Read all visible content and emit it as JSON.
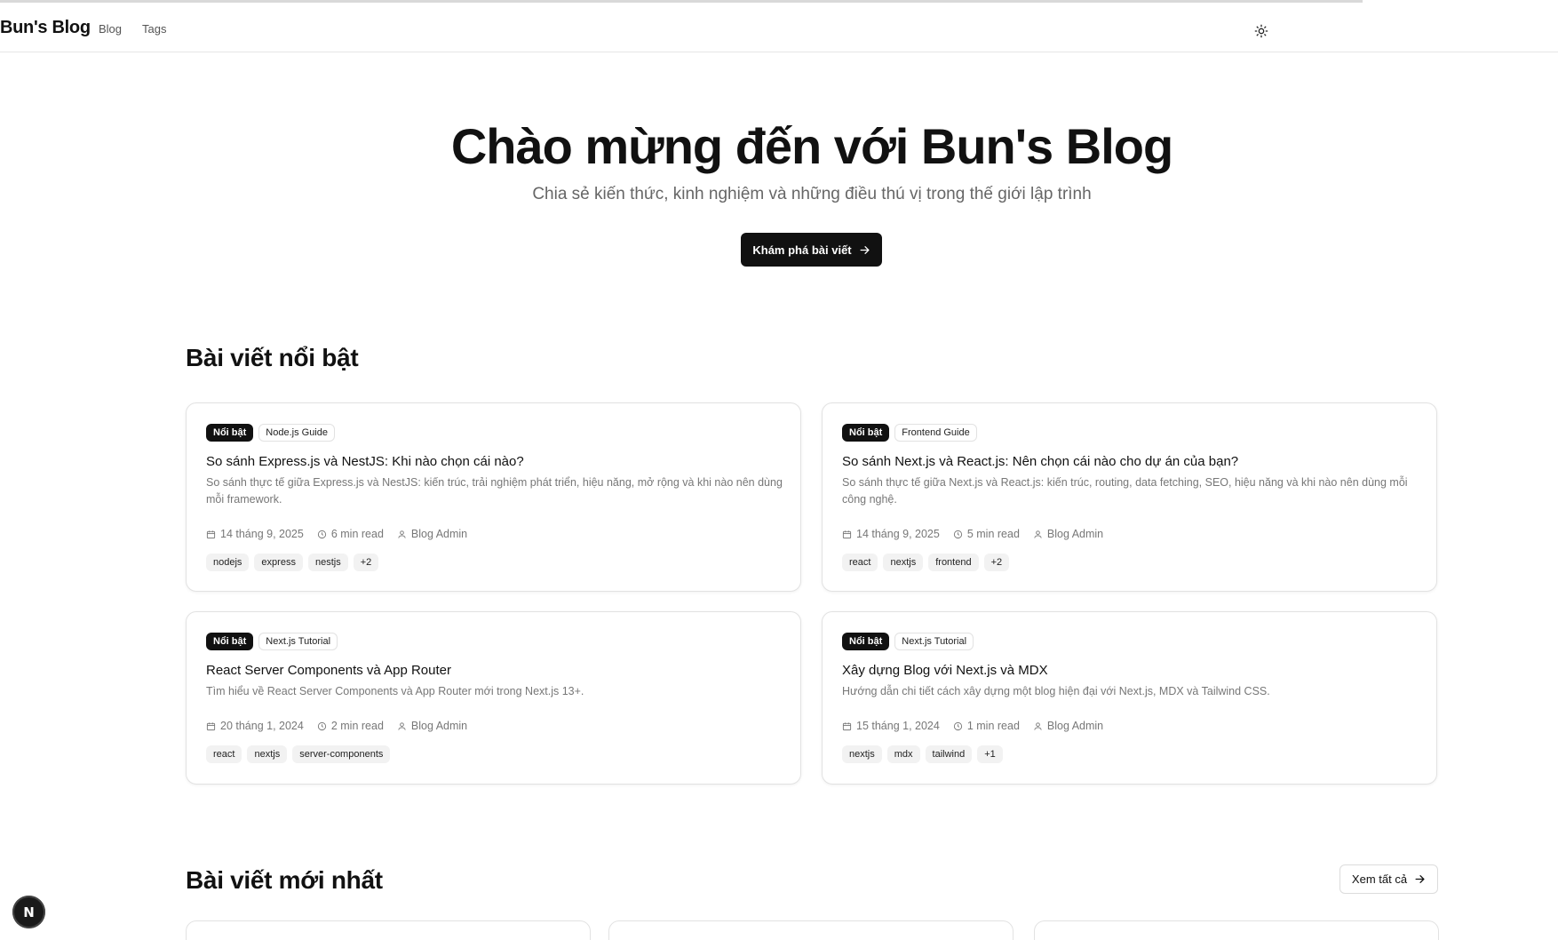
{
  "header": {
    "brand": "Bun's Blog",
    "nav": [
      "Blog",
      "Tags"
    ],
    "theme_icon": "sun-icon"
  },
  "hero": {
    "title": "Chào mừng đến với Bun's Blog",
    "subtitle": "Chia sẻ kiến thức, kinh nghiệm và những điều thú vị trong thế giới lập trình",
    "cta_label": "Khám phá bài viết"
  },
  "featured": {
    "title": "Bài viết nổi bật",
    "posts": [
      {
        "badge": "Nổi bật",
        "category": "Node.js Guide",
        "title": "So sánh Express.js và NestJS: Khi nào chọn cái nào?",
        "description": "So sánh thực tế giữa Express.js và NestJS: kiến trúc, trải nghiệm phát triển, hiệu năng, mở rộng và khi nào nên dùng mỗi framework.",
        "date": "14 tháng 9, 2025",
        "read_time": "6 min read",
        "author": "Blog Admin",
        "tags": [
          "nodejs",
          "express",
          "nestjs",
          "+2"
        ]
      },
      {
        "badge": "Nổi bật",
        "category": "Frontend Guide",
        "title": "So sánh Next.js và React.js: Nên chọn cái nào cho dự án của bạn?",
        "description": "So sánh thực tế giữa Next.js và React.js: kiến trúc, routing, data fetching, SEO, hiệu năng và khi nào nên dùng mỗi công nghệ.",
        "date": "14 tháng 9, 2025",
        "read_time": "5 min read",
        "author": "Blog Admin",
        "tags": [
          "react",
          "nextjs",
          "frontend",
          "+2"
        ]
      },
      {
        "badge": "Nổi bật",
        "category": "Next.js Tutorial",
        "title": "React Server Components và App Router",
        "description": "Tìm hiểu về React Server Components và App Router mới trong Next.js 13+.",
        "date": "20 tháng 1, 2024",
        "read_time": "2 min read",
        "author": "Blog Admin",
        "tags": [
          "react",
          "nextjs",
          "server-components"
        ]
      },
      {
        "badge": "Nổi bật",
        "category": "Next.js Tutorial",
        "title": "Xây dựng Blog với Next.js và MDX",
        "description": "Hướng dẫn chi tiết cách xây dựng một blog hiện đại với Next.js, MDX và Tailwind CSS.",
        "date": "15 tháng 1, 2024",
        "read_time": "1 min read",
        "author": "Blog Admin",
        "tags": [
          "nextjs",
          "mdx",
          "tailwind",
          "+1"
        ]
      }
    ]
  },
  "latest": {
    "title": "Bài viết mới nhất",
    "view_all_label": "Xem tất cả"
  },
  "next_badge": "N"
}
